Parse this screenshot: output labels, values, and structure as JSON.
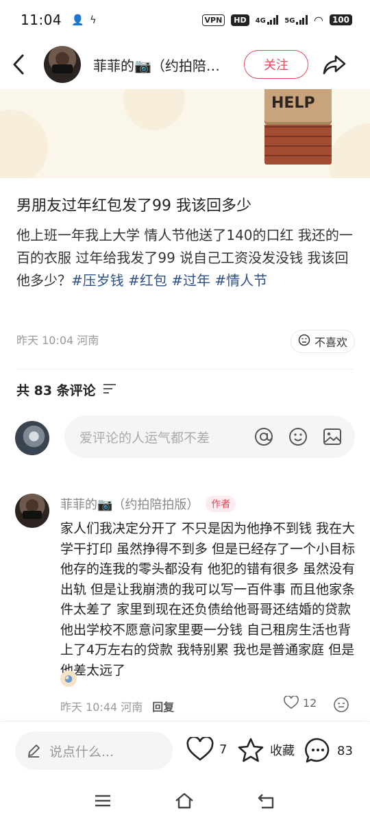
{
  "status_bar": {
    "time": "11:04",
    "vpn": "VPN",
    "hd": "HD",
    "net1": "4G",
    "net2": "5G",
    "battery": "100"
  },
  "nav": {
    "title": "菲菲的📷（约拍陪…",
    "follow_label": "关注"
  },
  "banner": {
    "sign_text": "HELP"
  },
  "post": {
    "title": "男朋友过年红包发了99 我该回多少",
    "body": "他上班一年我上大学 情人节他送了140的口红 我还的一百的衣服 过年给我发了99 说自己工资没发没钱 我该回他多少？",
    "tags": [
      "#压岁钱",
      "#红包",
      "#过年",
      "#情人节"
    ],
    "meta": "昨天 10:04 河南",
    "dislike_label": "不喜欢"
  },
  "comments_header": {
    "label": "共 83 条评论"
  },
  "comment_input": {
    "placeholder": "爱评论的人运气都不差"
  },
  "comment": {
    "author": "菲菲的📷（约拍陪拍版）",
    "badge": "作者",
    "body": "家人们我决定分开了 不只是因为他挣不到钱 我在大学干打印 虽然挣得不到多 但是已经存了一个小目标 他存的连我的零头都没有 他犯的错有很多 虽然没有出轨 但是让我崩溃的我可以写一百件事 而且他家条件太差了 家里到现在还负债给他哥哥还结婚的贷款 他出学校不愿意问家里要一分钱 自己租房生活也背上了4万左右的贷款 我特别累 我也是普通家庭 但是他差太远了",
    "meta": "昨天 10:44 河南",
    "reply_label": "回复",
    "likes": "12"
  },
  "bottom_bar": {
    "say_placeholder": "说点什么...",
    "likes": "7",
    "collect_label": "收藏",
    "comments": "83"
  },
  "colors": {
    "accent": "#e4485a",
    "tag": "#2b4f8a"
  }
}
